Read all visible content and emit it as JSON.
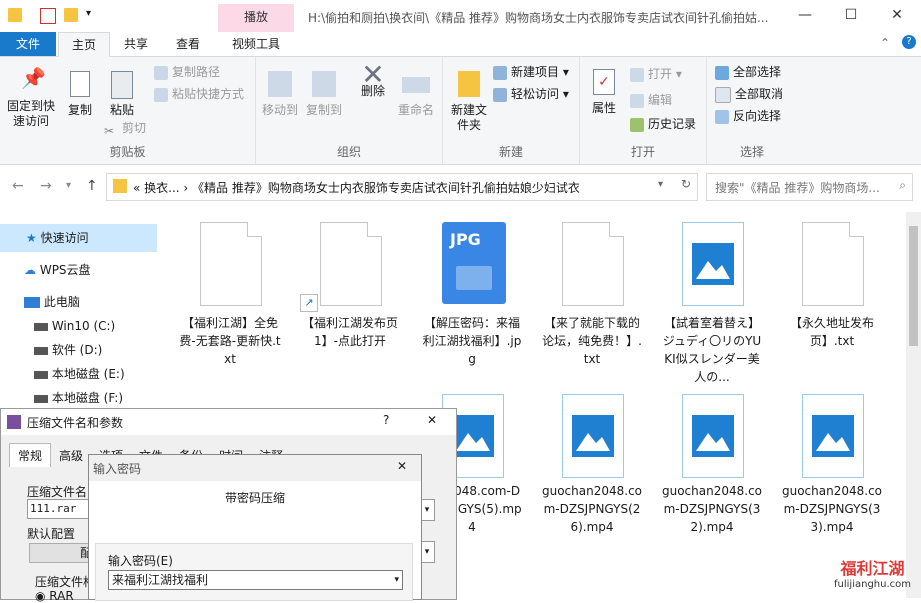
{
  "title_bar": {
    "context_tab": "播放",
    "path": "H:\\偷拍和厕拍\\换衣间\\《精品 推荐》购物商场女士内衣服饰专卖店试衣间针孔偷拍姑...",
    "min": "—",
    "max": "☐",
    "close": "✕"
  },
  "tabs": [
    "文件",
    "主页",
    "共享",
    "查看",
    "视频工具"
  ],
  "ribbon": {
    "clipboard": {
      "label": "剪贴板",
      "pin": "固定到快速访问",
      "copy": "复制",
      "paste": "粘贴",
      "copy_path": "复制路径",
      "paste_shortcut": "粘贴快捷方式",
      "cut": "剪切"
    },
    "organize": {
      "label": "组织",
      "move_to": "移动到",
      "copy_to": "复制到",
      "delete": "删除",
      "rename": "重命名"
    },
    "new": {
      "label": "新建",
      "new_folder": "新建文件夹",
      "new_item": "新建项目",
      "easy_access": "轻松访问"
    },
    "open": {
      "label": "打开",
      "properties": "属性",
      "open": "打开",
      "edit": "编辑",
      "history": "历史记录"
    },
    "select": {
      "label": "选择",
      "select_all": "全部选择",
      "select_none": "全部取消",
      "invert": "反向选择"
    }
  },
  "address": {
    "crumb1": "换衣...",
    "crumb2": "《精品 推荐》购物商场女士内衣服饰专卖店试衣间针孔偷拍姑娘少妇试衣",
    "search_placeholder": "搜索\"《精品 推荐》购物商场..."
  },
  "nav": {
    "quick": "快速访问",
    "wps": "WPS云盘",
    "pc": "此电脑",
    "drives": [
      "Win10 (C:)",
      "软件 (D:)",
      "本地磁盘 (E:)",
      "本地磁盘 (F:)"
    ]
  },
  "files_row1": [
    {
      "name": "【福利江湖】全免费-无套路-更新快.txt",
      "kind": "doc"
    },
    {
      "name": "【福利江湖发布页1】-点此打开",
      "kind": "shortcut"
    },
    {
      "name": "【解压密码：来福利江湖找福利】.jpg",
      "kind": "jpg"
    },
    {
      "name": "【来了就能下载的论坛，纯免费！】.txt",
      "kind": "doc"
    },
    {
      "name": "【試着室着替え】ジュディ〇リのYUKI似スレンダー美人の...",
      "kind": "img"
    },
    {
      "name": "【永久地址发布页】.txt",
      "kind": "doc"
    }
  ],
  "files_row2": [
    {
      "name": "han2048.com-DZSJPNGYS(5).mp4"
    },
    {
      "name": "guochan2048.com-DZSJPNGYS(26).mp4"
    },
    {
      "name": "guochan2048.com-DZSJPNGYS(32).mp4"
    },
    {
      "name": "guochan2048.com-DZSJPNGYS(33).mp4"
    }
  ],
  "jpg_badge": "JPG",
  "dlg_archive": {
    "title": "压缩文件名和参数",
    "help": "?",
    "close": "✕",
    "tabs": [
      "常规",
      "高级",
      "选项",
      "文件",
      "备份",
      "时间",
      "注释"
    ],
    "archive_name_label": "压缩文件名",
    "archive_name": "111.rar",
    "profile_label": "默认配置",
    "profile_btn": "配",
    "format_label": "压缩文件格",
    "format_opt": "RAR"
  },
  "dlg_password": {
    "title": "输入密码",
    "close": "✕",
    "heading": "带密码压缩",
    "field_label": "输入密码(E)",
    "value": "来福利江湖找福利"
  },
  "watermark": {
    "cn": "福利江湖",
    "url": "fulijianghu.com"
  },
  "colors": {
    "accent": "#1979ca",
    "selected": "#cce8ff",
    "context_tab": "#fcd9e6",
    "image_icon": "#1f80d2"
  }
}
